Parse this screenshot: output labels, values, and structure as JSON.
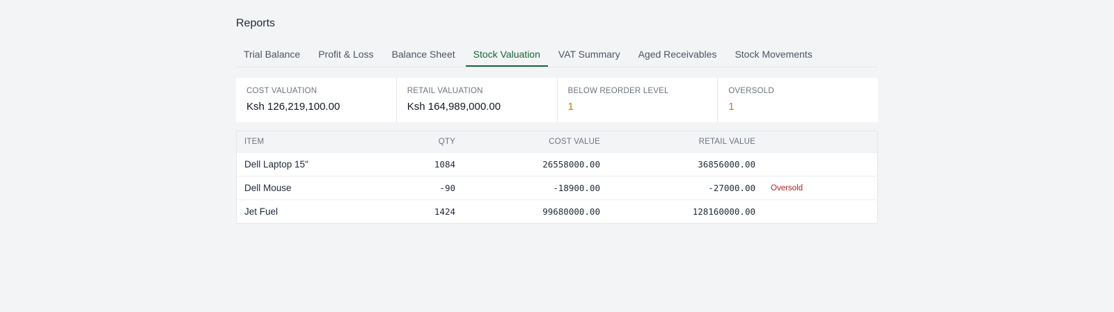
{
  "page": {
    "title": "Reports"
  },
  "tabs": [
    {
      "label": "Trial Balance"
    },
    {
      "label": "Profit & Loss"
    },
    {
      "label": "Balance Sheet"
    },
    {
      "label": "Stock Valuation",
      "active": true
    },
    {
      "label": "VAT Summary"
    },
    {
      "label": "Aged Receivables"
    },
    {
      "label": "Stock Movements"
    }
  ],
  "summary": [
    {
      "label": "COST VALUATION",
      "value": "Ksh 126,219,100.00"
    },
    {
      "label": "RETAIL VALUATION",
      "value": "Ksh 164,989,000.00"
    },
    {
      "label": "BELOW REORDER LEVEL",
      "value": "1"
    },
    {
      "label": "OVERSOLD",
      "value": "1"
    }
  ],
  "table": {
    "headers": {
      "item": "ITEM",
      "qty": "QTY",
      "cost": "COST VALUE",
      "retail": "RETAIL VALUE"
    },
    "rows": [
      {
        "item": "Dell Laptop 15\"",
        "qty": "1084",
        "cost": "26558000.00",
        "retail": "36856000.00",
        "status": ""
      },
      {
        "item": "Dell Mouse",
        "qty": "-90",
        "cost": "-18900.00",
        "retail": "-27000.00",
        "status": "Oversold"
      },
      {
        "item": "Jet Fuel",
        "qty": "1424",
        "cost": "99680000.00",
        "retail": "128160000.00",
        "status": ""
      }
    ]
  },
  "colors": {
    "accent": "#166534",
    "warning": "#b8860b",
    "danger": "#b91c1c",
    "background": "#f3f4f6"
  }
}
